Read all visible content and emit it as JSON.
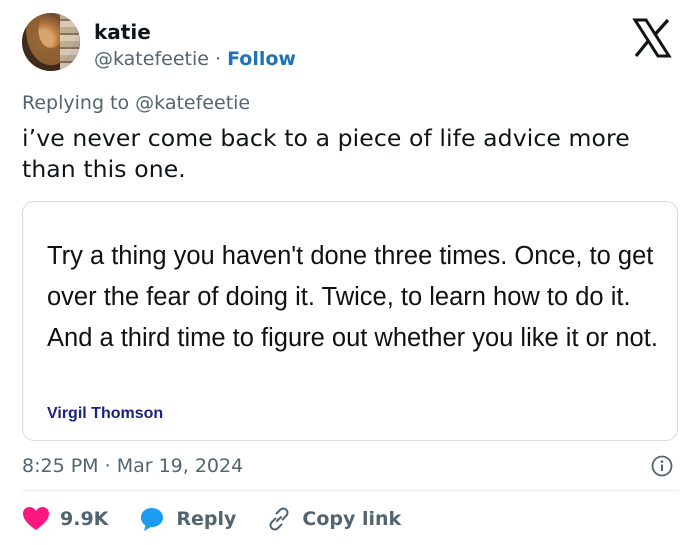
{
  "author": {
    "name": "katie",
    "handle": "@katefeetie",
    "separator": "·",
    "follow_label": "Follow"
  },
  "reply_context": {
    "prefix": "Replying to",
    "handle": "@katefeetie"
  },
  "tweet": {
    "text": "i’ve never come back to a piece of life advice more than this one."
  },
  "quote_card": {
    "text": "Try a thing you haven't done three times. Once, to get over the fear of doing it. Twice, to learn how to do it. And a third time to figure out whether you like it or not.",
    "author": "Virgil Thomson"
  },
  "meta": {
    "time": "8:25 PM",
    "separator": "·",
    "date": "Mar 19, 2024"
  },
  "actions": {
    "likes": "9.9K",
    "reply_label": "Reply",
    "copy_link_label": "Copy link"
  },
  "colors": {
    "like": "#f91880",
    "reply": "#1d9bf0",
    "follow": "#1d72b8",
    "quote_author": "#1a237e",
    "muted": "#536471"
  },
  "icons": [
    "x-logo-icon",
    "info-icon",
    "heart-icon",
    "reply-bubble-icon",
    "link-icon"
  ]
}
